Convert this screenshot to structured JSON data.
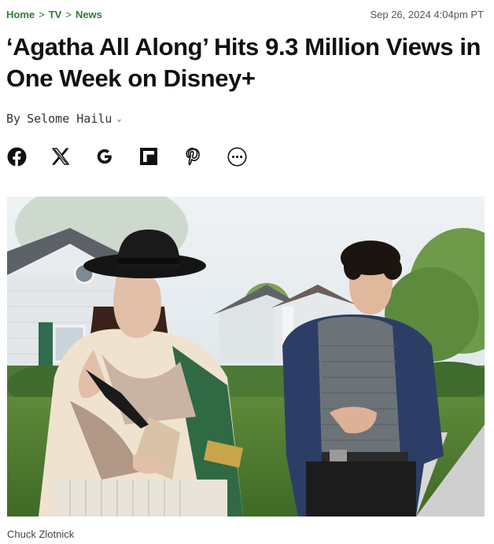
{
  "breadcrumb": {
    "items": [
      "Home",
      "TV",
      "News"
    ],
    "separator": ">"
  },
  "timestamp": "Sep 26, 2024 4:04pm PT",
  "headline": "‘Agatha All Along’ Hits 9.3 Million Views in One Week on Disney+",
  "byline": {
    "prefix": "By",
    "author": "Selome Hailu",
    "caret": "⌄"
  },
  "share_buttons": [
    {
      "name": "facebook",
      "icon": "facebook-icon"
    },
    {
      "name": "x",
      "icon": "x-icon"
    },
    {
      "name": "google",
      "icon": "google-icon"
    },
    {
      "name": "flipboard",
      "icon": "flipboard-icon"
    },
    {
      "name": "pinterest",
      "icon": "pinterest-icon"
    },
    {
      "name": "more",
      "icon": "more-icon"
    }
  ],
  "hero_image": {
    "credit": "Chuck Zlotnick"
  }
}
